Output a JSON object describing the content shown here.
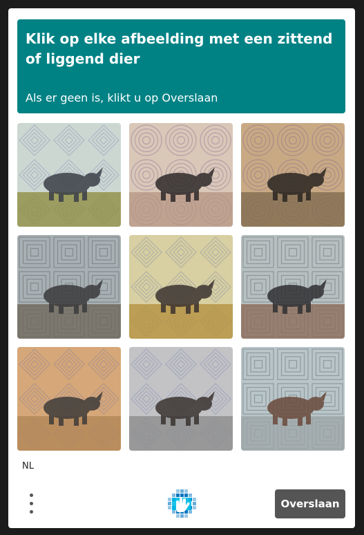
{
  "header": {
    "title": "Klik op elke afbeelding met een zittend of liggend dier",
    "subtitle": "Als er geen is, klikt u op Overslaan"
  },
  "grid": {
    "tiles": [
      {
        "name": "tile-1",
        "bg": "#cdd7d2",
        "ground": "#8b8a3a",
        "animal": "#3b3f48",
        "pattern": "diamond"
      },
      {
        "name": "tile-2",
        "bg": "#d9c7b8",
        "ground": "#b59683",
        "animal": "#2e2a2a",
        "pattern": "circle"
      },
      {
        "name": "tile-3",
        "bg": "#c8a984",
        "ground": "#7d6a4e",
        "animal": "#2a2622",
        "pattern": "circle"
      },
      {
        "name": "tile-4",
        "bg": "#a7b0b2",
        "ground": "#6e6658",
        "animal": "#3a3a3c",
        "pattern": "square"
      },
      {
        "name": "tile-5",
        "bg": "#d8cfa2",
        "ground": "#b38d3a",
        "animal": "#3b3330",
        "pattern": "diamond"
      },
      {
        "name": "tile-6",
        "bg": "#b7c0c0",
        "ground": "#8b6a55",
        "animal": "#2f3032",
        "pattern": "square"
      },
      {
        "name": "tile-7",
        "bg": "#d6a778",
        "ground": "#b08455",
        "animal": "#3e3b3a",
        "pattern": "diamond"
      },
      {
        "name": "tile-8",
        "bg": "#c3c3c6",
        "ground": "#8a8a8a",
        "animal": "#3a3330",
        "pattern": "diamond"
      },
      {
        "name": "tile-9",
        "bg": "#b9c6c9",
        "ground": "#9da6a7",
        "animal": "#6a4a3b",
        "pattern": "square"
      }
    ]
  },
  "footer": {
    "language": "NL",
    "skip_label": "Overslaan",
    "skip_color": "#555555"
  },
  "colors": {
    "header_bg": "#008285"
  }
}
